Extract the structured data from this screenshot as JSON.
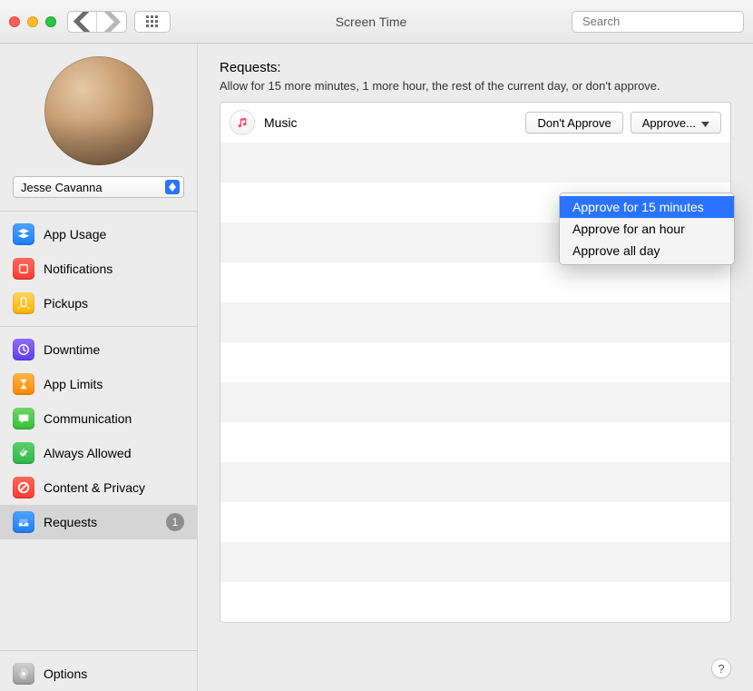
{
  "window": {
    "title": "Screen Time",
    "search_placeholder": "Search"
  },
  "user": {
    "name": "Jesse Cavanna"
  },
  "sidebar": {
    "groups": [
      [
        {
          "id": "app-usage",
          "label": "App Usage",
          "color": "iconbg-blue",
          "icon": "stack"
        },
        {
          "id": "notifications",
          "label": "Notifications",
          "color": "iconbg-red",
          "icon": "bell"
        },
        {
          "id": "pickups",
          "label": "Pickups",
          "color": "iconbg-yellow",
          "icon": "pickup"
        }
      ],
      [
        {
          "id": "downtime",
          "label": "Downtime",
          "color": "iconbg-purple",
          "icon": "clock"
        },
        {
          "id": "app-limits",
          "label": "App Limits",
          "color": "iconbg-orange",
          "icon": "hourglass"
        },
        {
          "id": "communication",
          "label": "Communication",
          "color": "iconbg-green",
          "icon": "bubble"
        },
        {
          "id": "always-allowed",
          "label": "Always Allowed",
          "color": "iconbg-green2",
          "icon": "check"
        },
        {
          "id": "content-privacy",
          "label": "Content & Privacy",
          "color": "iconbg-redcircle",
          "icon": "nosign"
        },
        {
          "id": "requests",
          "label": "Requests",
          "color": "iconbg-blue2",
          "icon": "tray",
          "selected": true,
          "badge": "1"
        }
      ]
    ],
    "options_label": "Options"
  },
  "main": {
    "title": "Requests:",
    "subtitle": "Allow for 15 more minutes, 1 more hour, the rest of the current day, or don't approve.",
    "request": {
      "app_name": "Music",
      "dont_approve_label": "Don't Approve",
      "approve_label": "Approve..."
    },
    "approve_menu": [
      "Approve for 15 minutes",
      "Approve for an hour",
      "Approve all day"
    ],
    "approve_menu_highlight_index": 0,
    "help_label": "?",
    "row_count": 13
  }
}
